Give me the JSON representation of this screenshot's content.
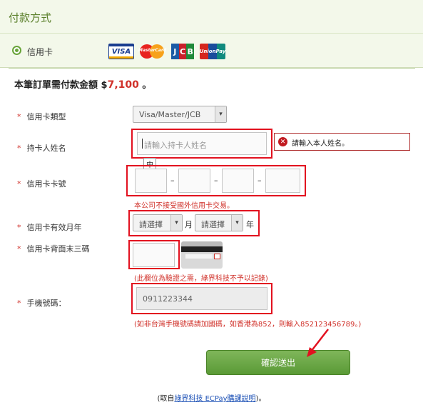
{
  "header": {
    "title": "付款方式"
  },
  "payment_method": {
    "label": "信用卡",
    "logos": [
      "VISA",
      "MasterCard",
      "JCB",
      "UnionPay"
    ]
  },
  "amount": {
    "prefix": "本筆訂單需付款金額 $",
    "value": "7,100",
    "suffix": " 。"
  },
  "card_type": {
    "label": "信用卡類型",
    "value": "Visa/Master/JCB"
  },
  "holder_name": {
    "label": "持卡人姓名",
    "placeholder": "請輸入持卡人姓名",
    "ime_glyph": "中",
    "error": "請輸入本人姓名。"
  },
  "card_number": {
    "label": "信用卡卡號",
    "separator": "–",
    "note": "本公司不接受國外信用卡交易。"
  },
  "expiry": {
    "label": "信用卡有效月年",
    "month_placeholder": "請選擇",
    "month_unit": "月",
    "year_placeholder": "請選擇",
    "year_unit": "年"
  },
  "cvv": {
    "label": "信用卡背面末三碼",
    "note": "(此欄位為驗證之需，綠界科技不予以記錄)"
  },
  "phone": {
    "label": "手機號碼：",
    "value": "0911223344",
    "note": "(如非台灣手機號碼請加國碼，如香港為852，則輸入852123456789。)"
  },
  "submit": {
    "label": "確認送出"
  },
  "caption": {
    "prefix": "(取自",
    "link": "綠界科技 ECPay購課說明",
    "suffix": ")。"
  },
  "required_mark": "*",
  "colors": {
    "accent_green": "#69a43a",
    "error_red": "#e2111f",
    "amount_red": "#d0312a"
  }
}
